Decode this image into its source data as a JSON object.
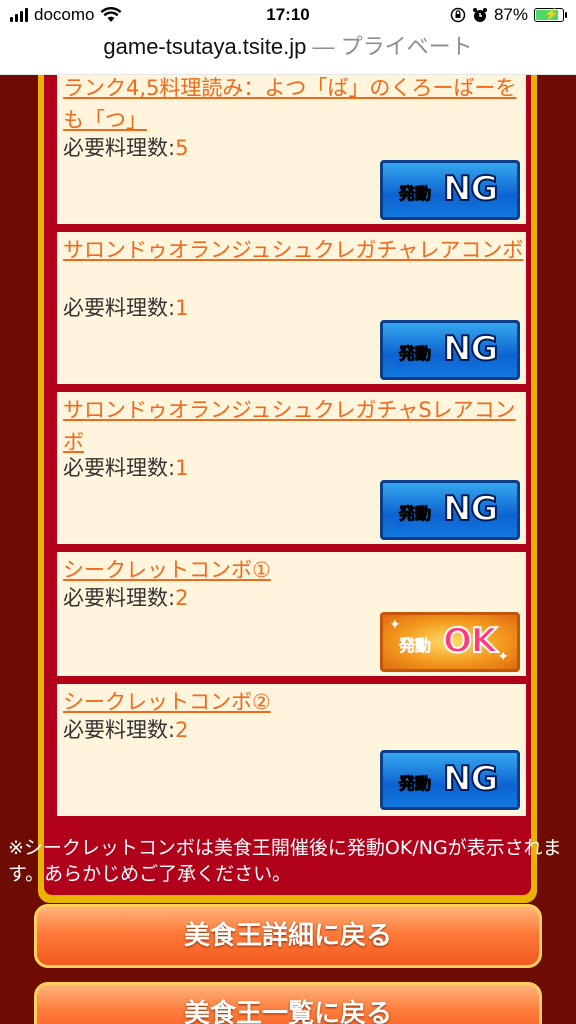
{
  "status_bar": {
    "carrier": "docomo",
    "time": "17:10",
    "battery_percent": "87%",
    "battery_level": 0.87,
    "icons": [
      "signal-icon",
      "wifi-icon",
      "rotation-lock-icon",
      "alarm-icon",
      "battery-charging-icon"
    ]
  },
  "browser": {
    "host": "game-tsutaya.tsite.jp",
    "mode": " — プライベート"
  },
  "entries": [
    {
      "title": "ランク4,5料理読み：よつ「ば」のくろーばーをも「つ」",
      "req_label": "必要料理数:",
      "req_value": "5",
      "badge": {
        "small": "発動",
        "big": "NG",
        "state": "NG"
      }
    },
    {
      "title": "サロンドゥオランジュシュクレガチャレアコンボ",
      "req_label": "必要料理数:",
      "req_value": "1",
      "badge": {
        "small": "発動",
        "big": "NG",
        "state": "NG"
      }
    },
    {
      "title": "サロンドゥオランジュシュクレガチャSレアコンボ",
      "req_label": "必要料理数:",
      "req_value": "1",
      "badge": {
        "small": "発動",
        "big": "NG",
        "state": "NG"
      }
    },
    {
      "title": "シークレットコンボ①",
      "req_label": "必要料理数:",
      "req_value": "2",
      "badge": {
        "small": "発動",
        "big": "OK",
        "state": "OK"
      }
    },
    {
      "title": "シークレットコンボ②",
      "req_label": "必要料理数:",
      "req_value": "2",
      "badge": {
        "small": "発動",
        "big": "NG",
        "state": "NG"
      }
    }
  ],
  "note": "※シークレットコンボは美食王開催後に発動OK/NGが表示されます。あらかじめご了承ください。",
  "buttons": {
    "back_detail": "美食王詳細に戻る",
    "back_list": "美食王一覧に戻る"
  },
  "colors": {
    "background": "#6e0c04",
    "panel_border": "#b0001a",
    "entry_bg": "#fff5dc",
    "link": "#f06a1c",
    "ng_badge": "#0d63d0",
    "ok_badge": "#f39a1e"
  }
}
